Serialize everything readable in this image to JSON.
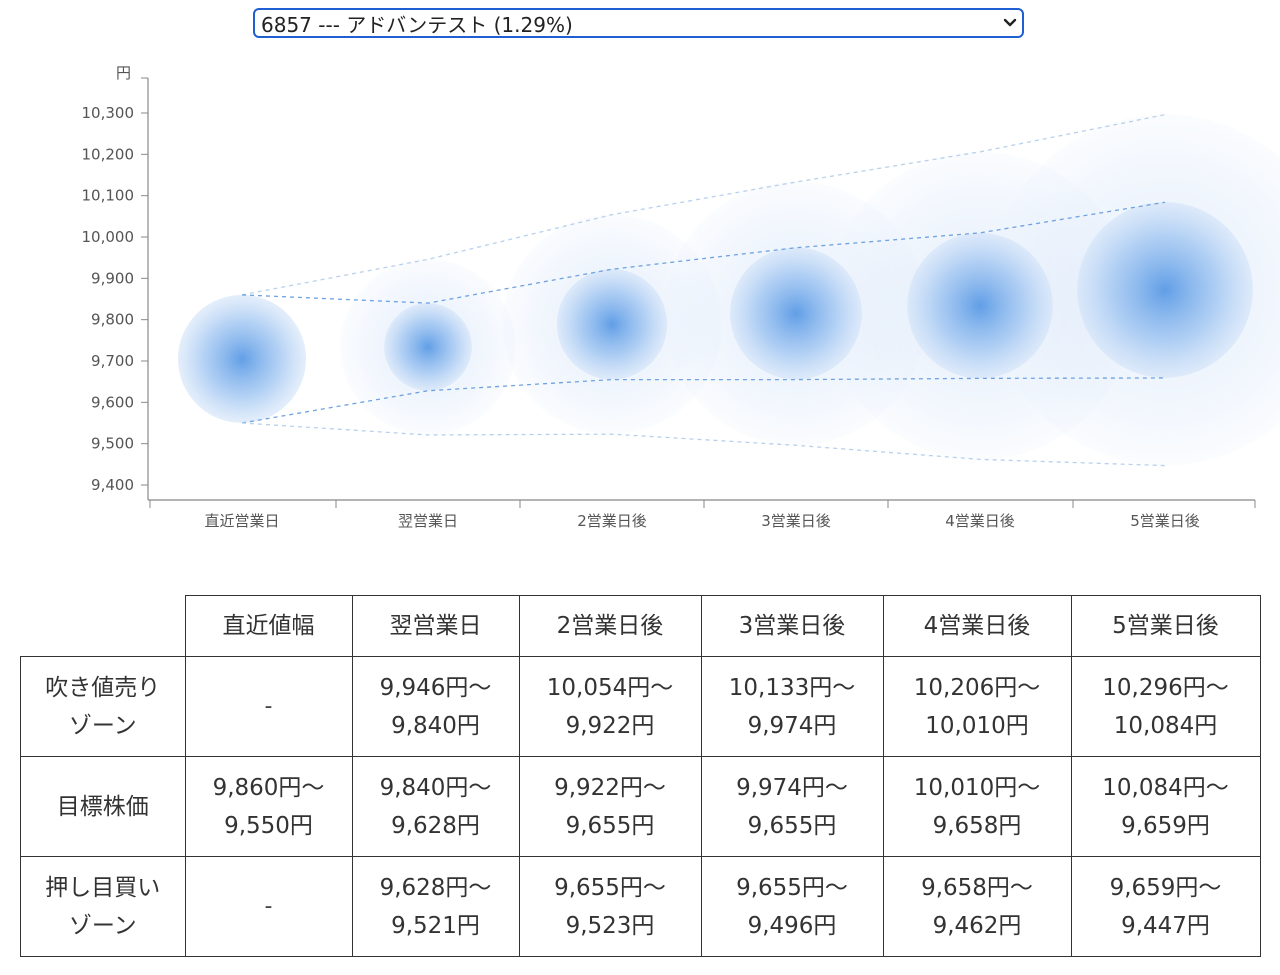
{
  "selector": {
    "selected": "6857 --- アドバンテスト (1.29%)"
  },
  "chart_data": {
    "type": "bubble-forecast",
    "y_unit_label": "円",
    "ylim": [
      9400,
      10300
    ],
    "y_ticks": [
      "9,400",
      "9,500",
      "9,600",
      "9,700",
      "9,800",
      "9,900",
      "10,000",
      "10,100",
      "10,200",
      "10,300"
    ],
    "y_tick_values": [
      9400,
      9500,
      9600,
      9700,
      9800,
      9900,
      10000,
      10100,
      10200,
      10300
    ],
    "categories": [
      "直近営業日",
      "翌営業日",
      "2営業日後",
      "3営業日後",
      "4営業日後",
      "5営業日後"
    ],
    "center_values": [
      9705,
      9734,
      9789,
      9815,
      9834,
      9872
    ],
    "series": [
      {
        "values": [
          9860,
          9946,
          10054,
          10133,
          10206,
          10296
        ]
      },
      {
        "values": [
          9860,
          9840,
          9922,
          9974,
          10010,
          10084
        ]
      },
      {
        "values": [
          9550,
          9628,
          9655,
          9655,
          9658,
          9659
        ]
      },
      {
        "values": [
          9550,
          9521,
          9523,
          9496,
          9462,
          9447
        ]
      }
    ],
    "colors": {
      "bubble_core": "#5b9be6",
      "bubble_outer": "#e6effb",
      "line_inner": "#6ea2e0",
      "line_outer": "#b8d0ee",
      "axis": "#888888"
    }
  },
  "table": {
    "headers": [
      "",
      "直近値幅",
      "翌営業日",
      "2営業日後",
      "3営業日後",
      "4営業日後",
      "5営業日後"
    ],
    "rows": [
      {
        "label": [
          "吹き値売り",
          "ゾーン"
        ],
        "cells": [
          [
            "-"
          ],
          [
            "9,946円〜",
            "9,840円"
          ],
          [
            "10,054円〜",
            "9,922円"
          ],
          [
            "10,133円〜",
            "9,974円"
          ],
          [
            "10,206円〜",
            "10,010円"
          ],
          [
            "10,296円〜",
            "10,084円"
          ]
        ]
      },
      {
        "label": [
          "目標株価"
        ],
        "cells": [
          [
            "9,860円〜",
            "9,550円"
          ],
          [
            "9,840円〜",
            "9,628円"
          ],
          [
            "9,922円〜",
            "9,655円"
          ],
          [
            "9,974円〜",
            "9,655円"
          ],
          [
            "10,010円〜",
            "9,658円"
          ],
          [
            "10,084円〜",
            "9,659円"
          ]
        ]
      },
      {
        "label": [
          "押し目買い",
          "ゾーン"
        ],
        "cells": [
          [
            "-"
          ],
          [
            "9,628円〜",
            "9,521円"
          ],
          [
            "9,655円〜",
            "9,523円"
          ],
          [
            "9,655円〜",
            "9,496円"
          ],
          [
            "9,658円〜",
            "9,462円"
          ],
          [
            "9,659円〜",
            "9,447円"
          ]
        ]
      }
    ]
  }
}
